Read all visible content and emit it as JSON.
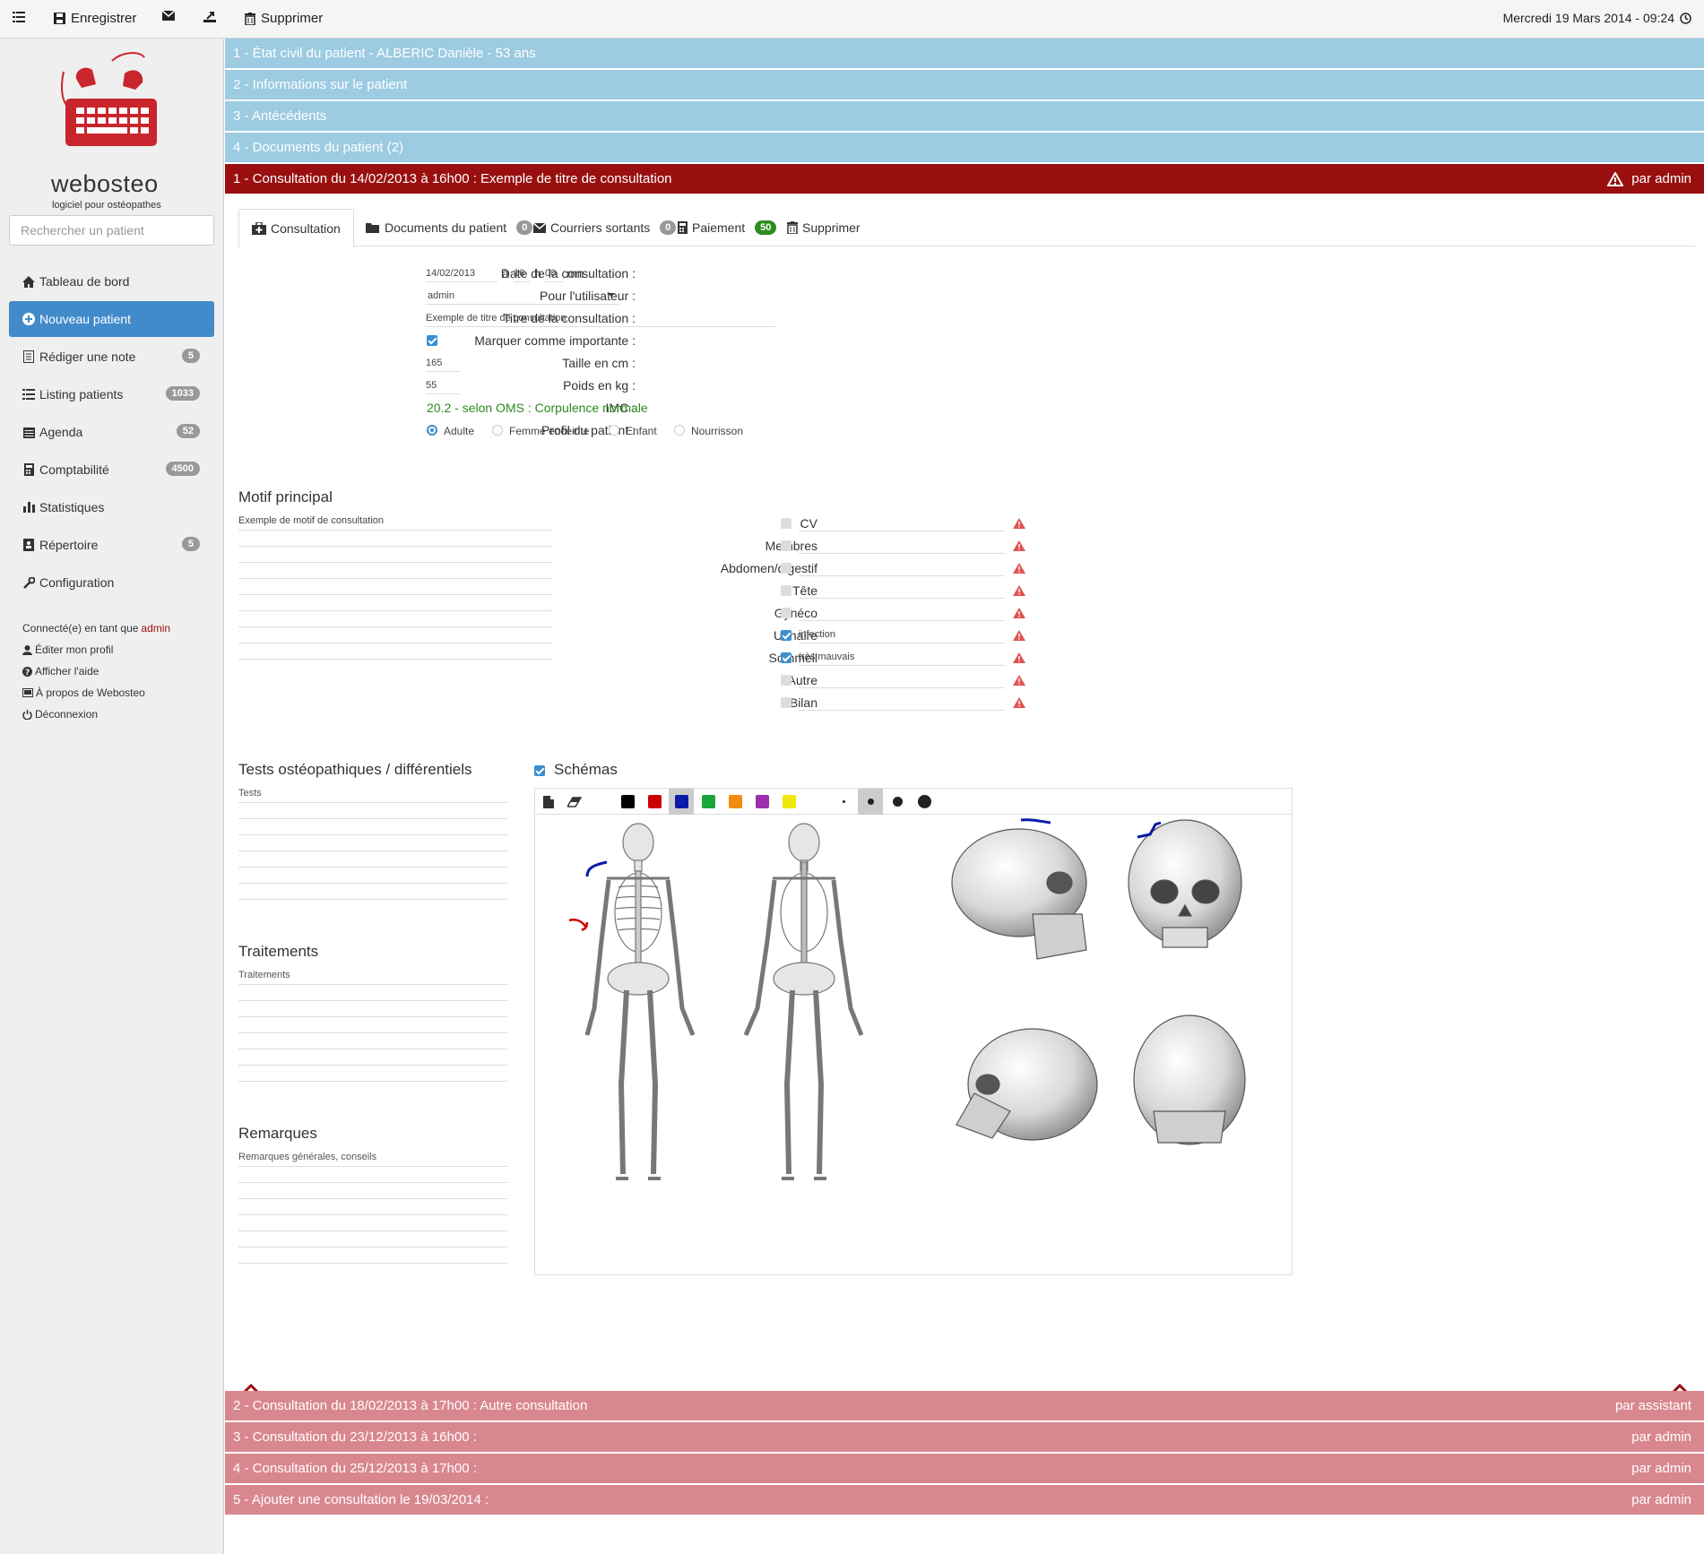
{
  "toolbar": {
    "save_label": "Enregistrer",
    "delete_label": "Supprimer",
    "datetime": "Mercredi 19 Mars 2014 - 09:24"
  },
  "brand": {
    "name": "webosteo",
    "tagline": "logiciel pour ostéopathes",
    "color": "#c9252c"
  },
  "search": {
    "placeholder": "Rechercher un patient"
  },
  "nav": [
    {
      "label": "Tableau de bord",
      "badge": "",
      "icon": "home-icon"
    },
    {
      "label": "Nouveau patient",
      "badge": "",
      "icon": "plus-circle-icon"
    },
    {
      "label": "Rédiger une note",
      "badge": "5",
      "icon": "note-icon"
    },
    {
      "label": "Listing patients",
      "badge": "1033",
      "icon": "list-icon"
    },
    {
      "label": "Agenda",
      "badge": "52",
      "icon": "calendar-icon"
    },
    {
      "label": "Comptabilité",
      "badge": "4500",
      "icon": "calculator-icon"
    },
    {
      "label": "Statistiques",
      "badge": "",
      "icon": "bar-chart-icon"
    },
    {
      "label": "Répertoire",
      "badge": "5",
      "icon": "contacts-icon"
    },
    {
      "label": "Configuration",
      "badge": "",
      "icon": "wrench-icon"
    }
  ],
  "user": {
    "connected_prefix": "Connecté(e) en tant que",
    "username": "admin",
    "edit_profile": "Éditer mon profil",
    "help": "Afficher l'aide",
    "about": "À propos de Webosteo",
    "logout": "Déconnexion"
  },
  "sections": [
    "1 - État civil du patient - ALBERIC Danièle - 53 ans",
    "2 - Informations sur le patient",
    "3 - Antécédents",
    "4 - Documents du patient (2)"
  ],
  "current_consultation": {
    "title": "1 - Consultation du 14/02/2013 à 16h00 : Exemple de titre de consultation",
    "author": "par admin"
  },
  "tabs": [
    {
      "label": "Consultation",
      "badge": ""
    },
    {
      "label": "Documents du patient",
      "badge": "0"
    },
    {
      "label": "Courriers sortants",
      "badge": "0"
    },
    {
      "label": "Paiement",
      "badge": "50"
    },
    {
      "label": "Supprimer",
      "badge": ""
    }
  ],
  "form": {
    "date_label": "Date de la consultation :",
    "date_value": "14/02/2013",
    "at": "à",
    "hour": "16",
    "h": "h",
    "minute": "00",
    "mn": "mn",
    "user_label": "Pour l'utilisateur :",
    "user_value": "admin",
    "title_label": "Titre de la consultation :",
    "title_value": "Exemple de titre de consultation",
    "important_label": "Marquer comme importante :",
    "height_label": "Taille en cm :",
    "height_value": "165",
    "weight_label": "Poids en kg :",
    "weight_value": "55",
    "imc_label": "IMC :",
    "imc_value": "20.2 - selon OMS : Corpulence normale",
    "profile_label": "Profil du patient :",
    "profiles": [
      "Adulte",
      "Femme enceinte",
      "Enfant",
      "Nourrisson"
    ]
  },
  "motif": {
    "heading": "Motif principal",
    "value": "Exemple de motif de consultation"
  },
  "systems": [
    {
      "label": "CV",
      "checked": false,
      "value": ""
    },
    {
      "label": "Membres",
      "checked": false,
      "value": ""
    },
    {
      "label": "Abdomen/digestif",
      "checked": false,
      "value": ""
    },
    {
      "label": "Tête",
      "checked": false,
      "value": ""
    },
    {
      "label": "Gynéco",
      "checked": false,
      "value": ""
    },
    {
      "label": "Urinaire",
      "checked": true,
      "value": "infection"
    },
    {
      "label": "Sommeil",
      "checked": true,
      "value": "très mauvais"
    },
    {
      "label": "Autre",
      "checked": false,
      "value": ""
    },
    {
      "label": "Bilan",
      "checked": false,
      "value": ""
    }
  ],
  "tests": {
    "heading": "Tests ostéopathiques / différentiels",
    "placeholder": "Tests"
  },
  "treatments": {
    "heading": "Traitements",
    "placeholder": "Traitements"
  },
  "remarks": {
    "heading": "Remarques",
    "placeholder": "Remarques générales, conseils"
  },
  "schemas": {
    "heading": "Schémas",
    "colors": [
      "#000000",
      "#cc0000",
      "#0a1ba8",
      "#1aa53a",
      "#f28c0f",
      "#9b2fae",
      "#f0e80c"
    ]
  },
  "other_consultations": [
    {
      "title": "2 - Consultation du 18/02/2013 à 17h00 : Autre consultation",
      "author": "par assistant"
    },
    {
      "title": "3 - Consultation du 23/12/2013 à 16h00 :",
      "author": "par admin"
    },
    {
      "title": "4 - Consultation du 25/12/2013 à 17h00 :",
      "author": "par admin"
    },
    {
      "title": "5 - Ajouter une consultation le 19/03/2014 :",
      "author": "par admin"
    }
  ],
  "colors": {
    "accordion_blue": "#9ccbe2",
    "current_red": "#990f0f",
    "other_pink": "#d9878f",
    "active_nav": "#428bca",
    "imc_green": "#2d8b1f",
    "warning": "#e05252"
  }
}
